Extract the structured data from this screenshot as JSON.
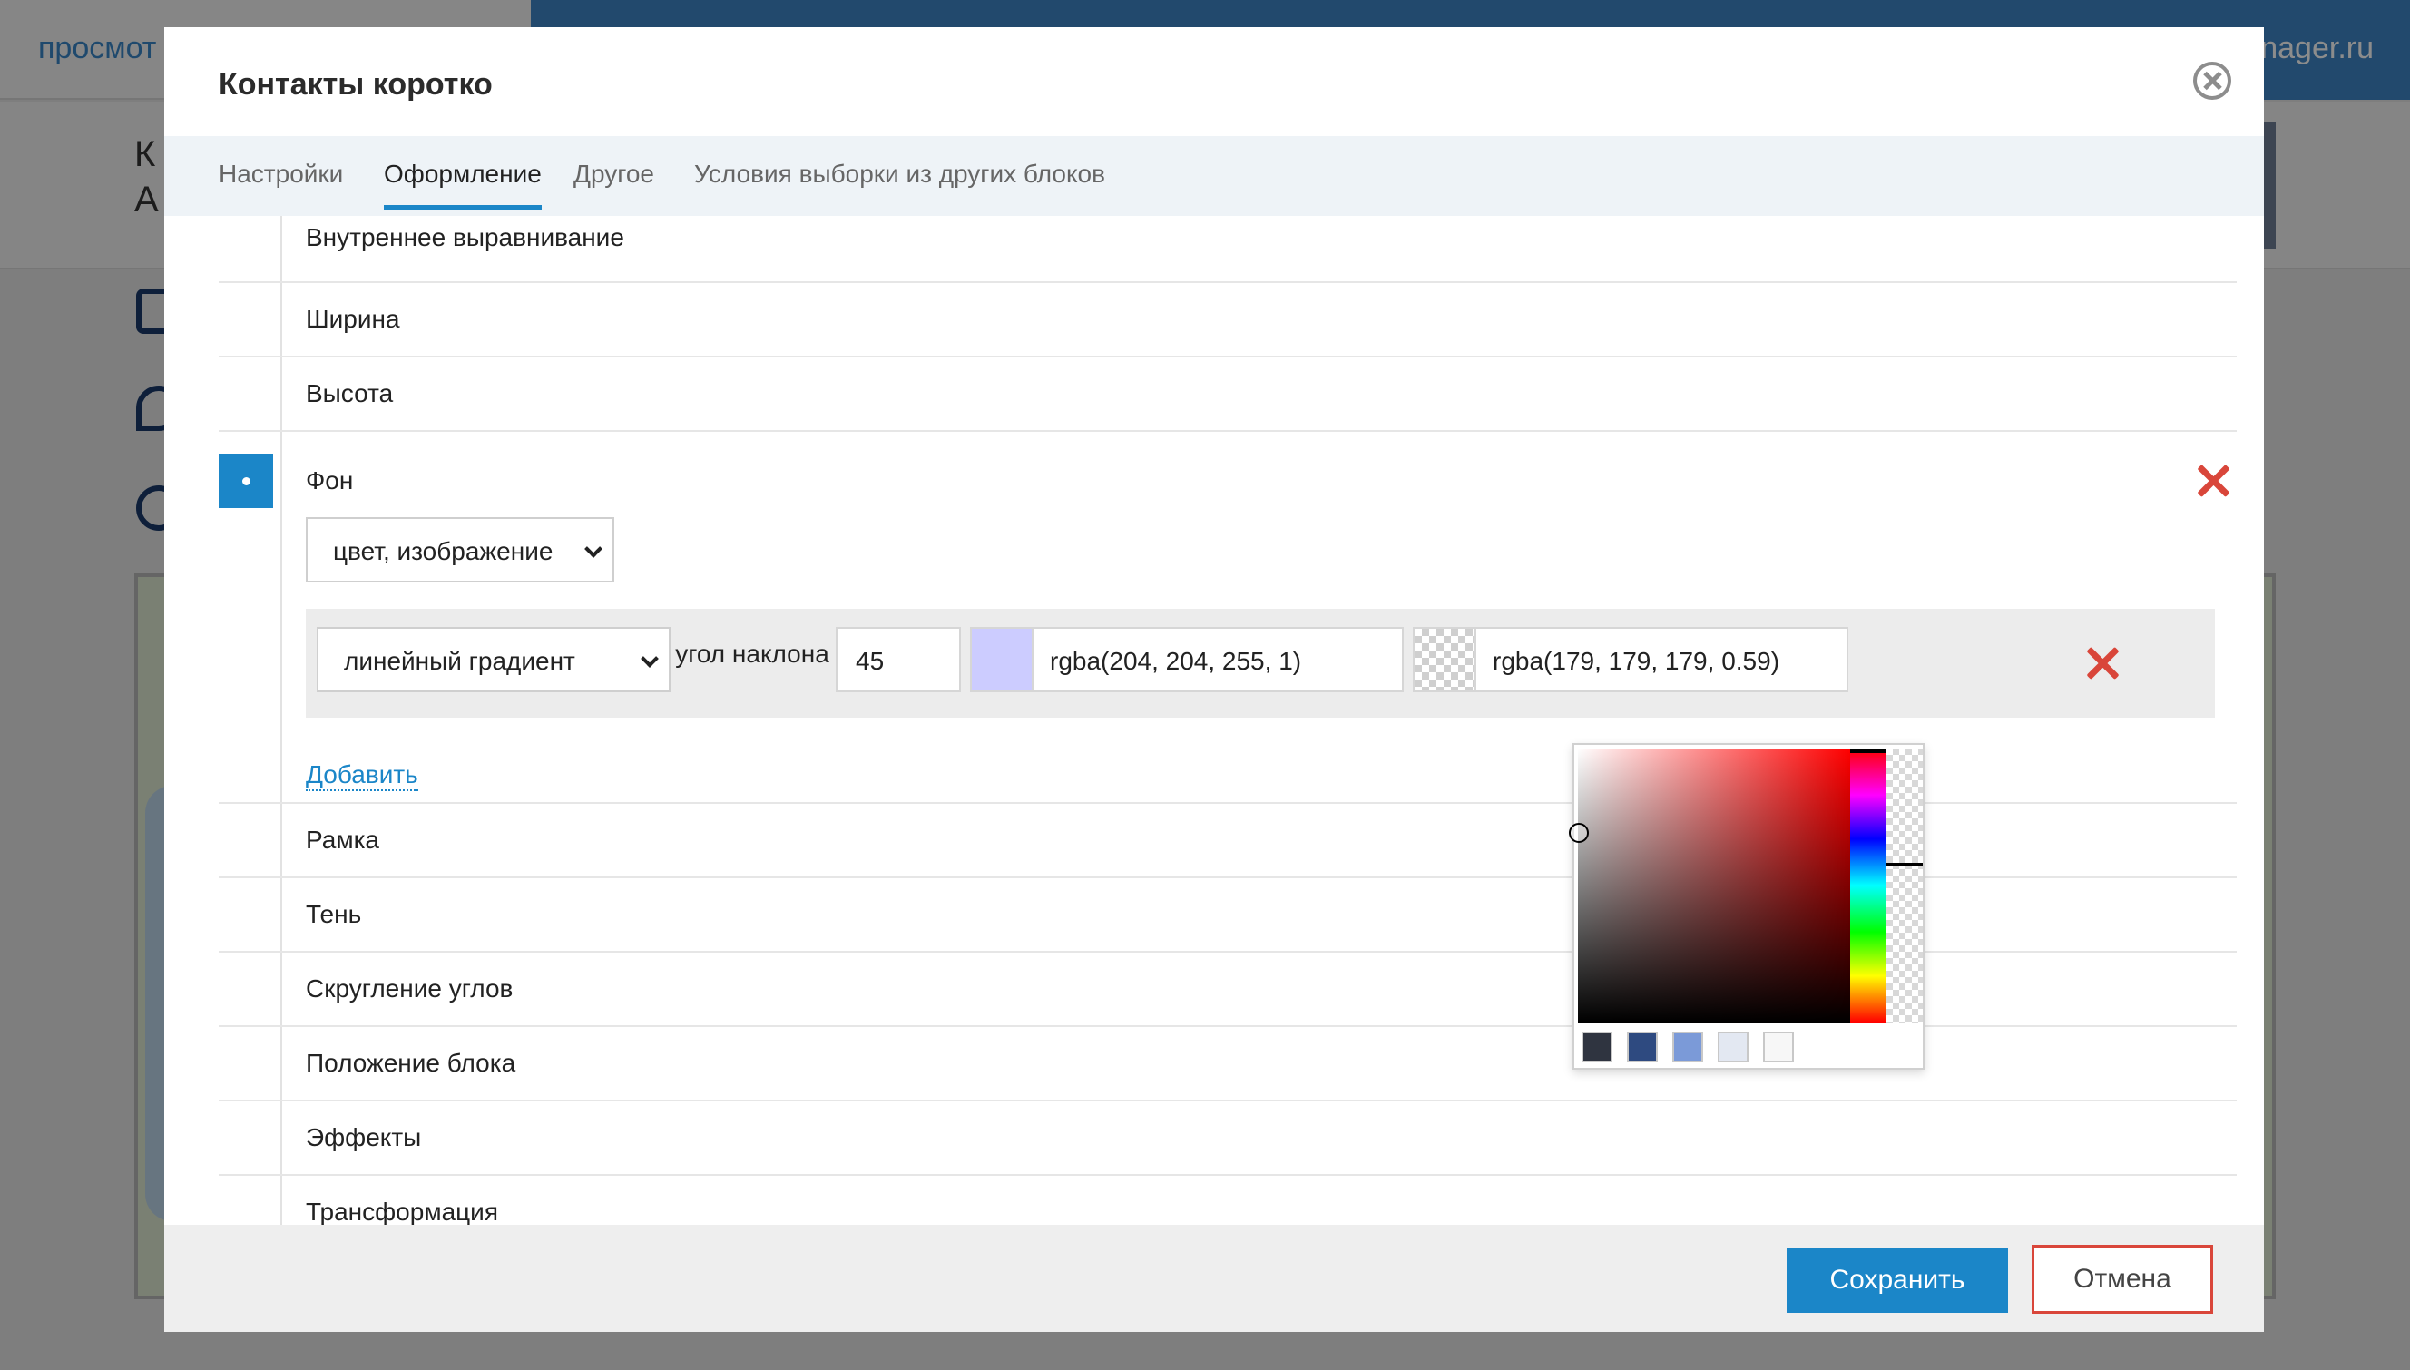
{
  "background": {
    "top_left_text": "просмот",
    "top_right_text": "nager.ru",
    "header_line1": "К",
    "header_line2": "А"
  },
  "modal": {
    "title": "Контакты коротко",
    "tabs": [
      {
        "label": "Настройки"
      },
      {
        "label": "Оформление"
      },
      {
        "label": "Другое"
      },
      {
        "label": "Условия выборки из других блоков"
      }
    ],
    "active_tab": "Оформление",
    "rows_top": [
      {
        "label": "Внутреннее выравнивание"
      },
      {
        "label": "Ширина"
      },
      {
        "label": "Высота"
      }
    ],
    "fon": {
      "label": "Фон",
      "type_select": "цвет, изображение",
      "gradient": {
        "type": "линейный градиент",
        "angle_label": "угол наклона",
        "angle_value": "45",
        "color1_swatch": "#ccccff",
        "color1": "rgba(204, 204, 255, 1)",
        "color2": "rgba(179, 179, 179, 0.59)"
      },
      "add_link": "Добавить"
    },
    "rows_bottom": [
      {
        "label": "Рамка"
      },
      {
        "label": "Тень"
      },
      {
        "label": "Скругление углов"
      },
      {
        "label": "Положение блока"
      },
      {
        "label": "Эффекты"
      },
      {
        "label": "Трансформация"
      }
    ],
    "color_picker": {
      "hue_color": "#ff0000",
      "palette": [
        "#2f3440",
        "#2e4a80",
        "#7b9ad8",
        "#e3e8f2",
        "#f7f7f7"
      ]
    },
    "footer": {
      "save_label": "Сохранить",
      "cancel_label": "Отмена"
    }
  },
  "colors": {
    "accent": "#1b86c8",
    "danger": "#d9463a"
  }
}
